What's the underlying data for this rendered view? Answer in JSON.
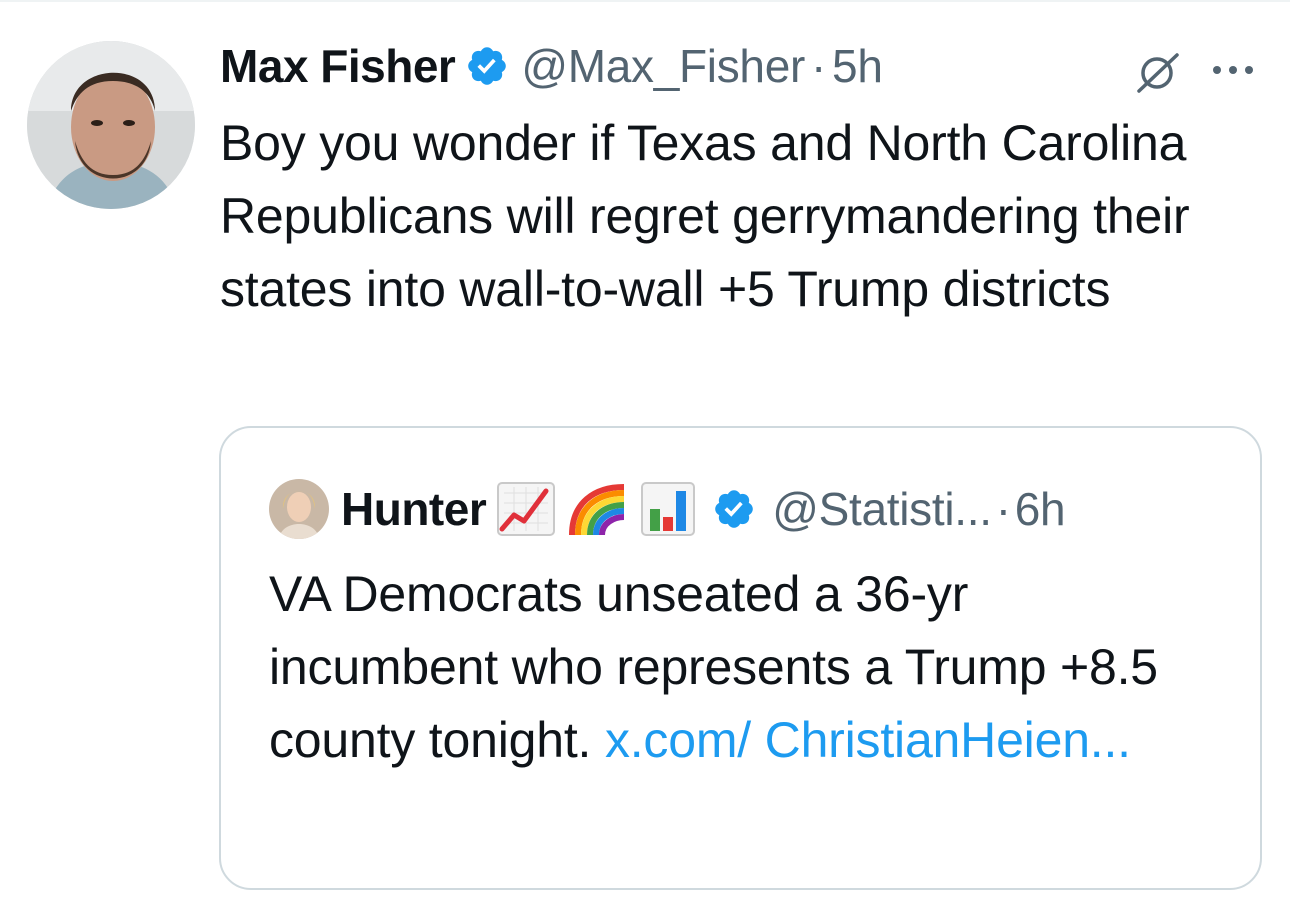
{
  "tweet": {
    "author_name": "Max Fisher",
    "handle": "@Max_Fisher",
    "separator": "·",
    "time": "5h",
    "text": "Boy you wonder if Texas and North Carolina Republicans will regret gerrymandering their states into wall-to-wall +5 Trump districts",
    "icons": {
      "grok": "grok-icon",
      "more": "more-icon",
      "verified": "verified-badge-icon"
    }
  },
  "quoted_tweet": {
    "author_name": "Hunter",
    "emojis": [
      "chart-increasing-emoji",
      "rainbow-emoji",
      "bar-chart-emoji"
    ],
    "handle": "@Statisti...",
    "separator": "·",
    "time": "6h",
    "text": "VA Democrats unseated a 36-yr incumbent who represents a Trump +8.5 county tonight.",
    "link_text": "x.com/ ChristianHeien..."
  },
  "colors": {
    "text": "#0f1419",
    "secondary": "#536471",
    "link": "#1d9bf0",
    "verified": "#1d9bf0",
    "border": "#cfd9de"
  }
}
